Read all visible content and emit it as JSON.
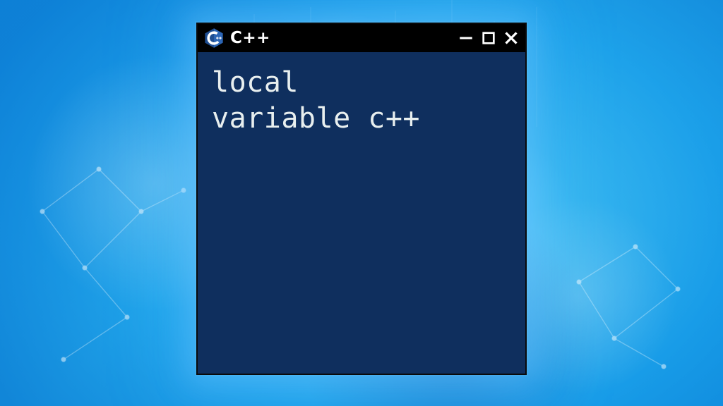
{
  "window": {
    "title": "C++",
    "logo_name": "cpp-hex-logo"
  },
  "content": {
    "line1": "local",
    "line2": "variable c++"
  },
  "colors": {
    "window_bg": "#0f2f5e",
    "titlebar_bg": "#000000",
    "text": "#e8efef"
  }
}
